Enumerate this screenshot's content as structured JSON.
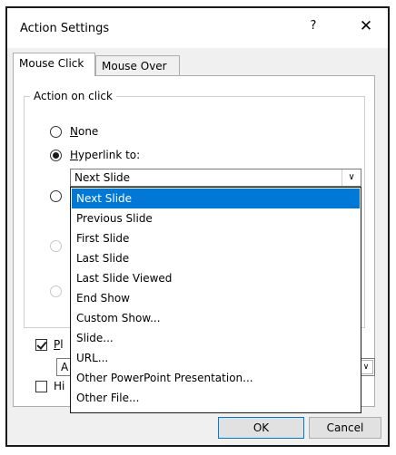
{
  "dialog": {
    "title": "Action Settings",
    "help": "?",
    "close": "✕"
  },
  "tabs": [
    {
      "label": "Mouse Click",
      "active": true
    },
    {
      "label": "Mouse Over",
      "active": false
    }
  ],
  "action_group": {
    "legend": "Action on click",
    "none": {
      "u": "N",
      "rest": "one"
    },
    "hyperlink": {
      "u": "H",
      "rest": "yperlink to:"
    },
    "hyperlink_value": "Next Slide"
  },
  "dropdown_items": [
    "Next Slide",
    "Previous Slide",
    "First Slide",
    "Last Slide",
    "Last Slide Viewed",
    "End Show",
    "Custom Show...",
    "Slide...",
    "URL...",
    "Other PowerPoint Presentation...",
    "Other File..."
  ],
  "play_sound": {
    "u": "P",
    "rest": "l"
  },
  "sound_value": "A",
  "highlight": {
    "text": "Hi"
  },
  "buttons": {
    "ok": "OK",
    "cancel": "Cancel"
  },
  "colors": {
    "selection": "#0078d7"
  }
}
